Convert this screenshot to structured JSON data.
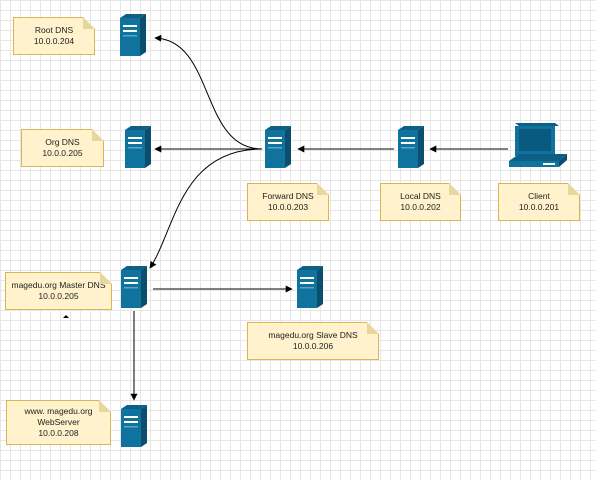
{
  "colors": {
    "server_front": "#10739e",
    "server_top": "#0e5f85",
    "server_side": "#0b4e6e",
    "note_fill": "#fff2cc",
    "note_border": "#d6b656",
    "edge": "#000000",
    "grid": "#e6e6e6"
  },
  "icons": {
    "server": "server-icon",
    "client": "pc-icon"
  },
  "nodes": {
    "root": {
      "name": "Root DNS",
      "ip": "10.0.0.204"
    },
    "org": {
      "name": "Org DNS",
      "ip": "10.0.0.205"
    },
    "forward": {
      "name": "Forward DNS",
      "ip": "10.0.0.203"
    },
    "local": {
      "name": "Local DNS",
      "ip": "10.0.0.202"
    },
    "client": {
      "name": "Client",
      "ip": "10.0.0.201"
    },
    "master": {
      "name": "magedu.org Master DNS",
      "ip": "10.0.0.205"
    },
    "slave": {
      "name": "magedu.org Slave DNS",
      "ip": "10.0.0.206"
    },
    "web": {
      "line1": "www. magedu.org",
      "line2": "WebServer",
      "ip": "10.0.0.208"
    }
  },
  "edges": [
    {
      "from": "client",
      "to": "local"
    },
    {
      "from": "local",
      "to": "forward"
    },
    {
      "from": "forward",
      "to": "org"
    },
    {
      "from": "forward",
      "to": "root"
    },
    {
      "from": "forward",
      "to": "master"
    },
    {
      "from": "master",
      "to": "slave"
    },
    {
      "from": "master",
      "to": "web"
    }
  ]
}
